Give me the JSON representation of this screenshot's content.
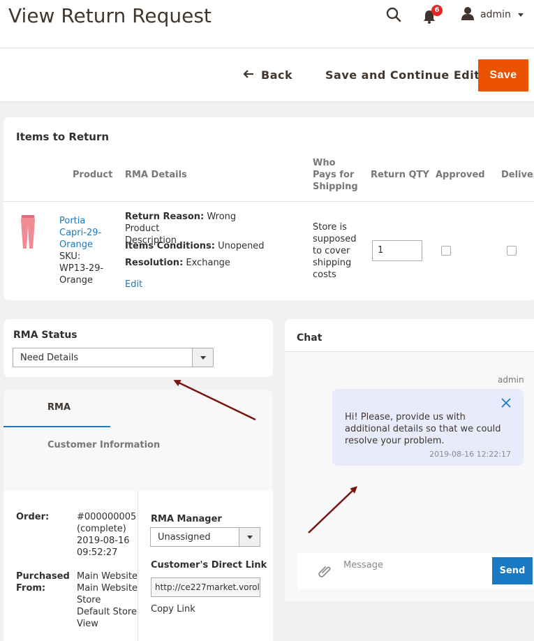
{
  "header": {
    "title": "View Return Request",
    "notifications_count": "6",
    "user_name": "admin"
  },
  "actions": {
    "back_label": "Back",
    "save_continue_label": "Save and Continue Edit",
    "save_label": "Save"
  },
  "items": {
    "title": "Items to Return",
    "columns": [
      "Product",
      "RMA Details",
      "Who Pays for Shipping",
      "Return QTY",
      "Approved",
      "Delivered"
    ],
    "columns_lines": {
      "who_pays": [
        "Who",
        "Pays for",
        "Shipping"
      ],
      "delivered_visible": "Delivere"
    },
    "row": {
      "product_name_lines": [
        "Portia",
        "Capri-29-",
        "Orange"
      ],
      "sku_lines": [
        "SKU:",
        "WP13-29-",
        "Orange"
      ],
      "return_reason_label": "Return Reason:",
      "return_reason_value": "Wrong Product",
      "return_reason_value_2": "Description",
      "items_conditions_label": "Items Conditions:",
      "items_conditions_value": "Unopened",
      "resolution_label": "Resolution:",
      "resolution_value": "Exchange",
      "edit_label": "Edit",
      "shipping_lines": [
        "Store is",
        "supposed",
        "to cover",
        "shipping",
        "costs"
      ],
      "return_qty": "1",
      "approved": false,
      "delivered": false
    }
  },
  "rma_status": {
    "title": "RMA Status",
    "selected": "Need Details"
  },
  "tabs": {
    "rma_label": "RMA",
    "customer_label": "Customer Information"
  },
  "order_info": {
    "order_label": "Order:",
    "order_number": "#000000005",
    "order_state": "(complete)",
    "order_date": "2019-08-16",
    "order_time": "09:52:27",
    "purchased_label_1": "Purchased",
    "purchased_label_2": "From:",
    "purchased_lines": [
      "Main Website",
      "Main Website",
      "Store",
      "Default Store",
      "View"
    ],
    "manager_label": "RMA Manager",
    "manager_selected": "Unassigned",
    "direct_link_label": "Customer's Direct Link",
    "direct_link_value": "http://ce227market.vorol",
    "copy_link_label": "Copy Link"
  },
  "chat": {
    "title": "Chat",
    "message_author": "admin",
    "message_text": "Hi! Please, provide us with additional details so that we could resolve your problem.",
    "message_time": "2019-08-16 12:22:17",
    "input_placeholder": "Message",
    "send_label": "Send"
  },
  "colors": {
    "accent_orange": "#eb5202",
    "link_blue": "#1979c3",
    "badge_red": "#e22626",
    "annotation_arrow": "#7a1212",
    "chat_bubble": "#e8ebfb"
  },
  "icons": [
    "search-icon",
    "bell-icon",
    "user-icon",
    "back-arrow-icon",
    "chevron-down-icon",
    "close-icon",
    "paperclip-icon"
  ]
}
